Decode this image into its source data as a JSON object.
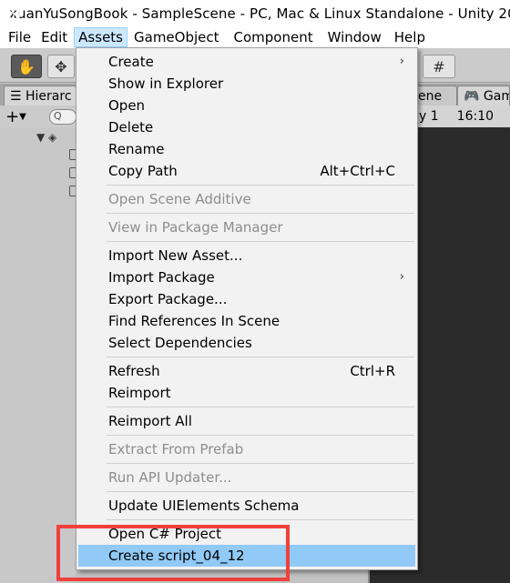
{
  "window": {
    "title": "xuanYuSongBook - SampleScene - PC, Mac & Linux Standalone - Unity 20"
  },
  "menubar": {
    "items": [
      "File",
      "Edit",
      "Assets",
      "GameObject",
      "Component",
      "Window",
      "Help"
    ]
  },
  "editor": {
    "tabs": {
      "hierarchy": "Hierarc",
      "scene": "ene",
      "game": "Gam"
    },
    "toolbar_right": {
      "display": "y 1",
      "time": "16:10"
    },
    "search_placeholder": "Q"
  },
  "assets_menu": {
    "items": [
      {
        "label": "Create",
        "submenu": true
      },
      {
        "label": "Show in Explorer"
      },
      {
        "label": "Open"
      },
      {
        "label": "Delete"
      },
      {
        "label": "Rename"
      },
      {
        "label": "Copy Path",
        "shortcut": "Alt+Ctrl+C"
      },
      {
        "label": "Open Scene Additive",
        "disabled": true
      },
      {
        "label": "View in Package Manager",
        "disabled": true
      },
      {
        "label": "Import New Asset..."
      },
      {
        "label": "Import Package",
        "submenu": true
      },
      {
        "label": "Export Package..."
      },
      {
        "label": "Find References In Scene"
      },
      {
        "label": "Select Dependencies"
      },
      {
        "label": "Refresh",
        "shortcut": "Ctrl+R"
      },
      {
        "label": "Reimport"
      },
      {
        "label": "Reimport All"
      },
      {
        "label": "Extract From Prefab",
        "disabled": true
      },
      {
        "label": "Run API Updater...",
        "disabled": true
      },
      {
        "label": "Update UIElements Schema"
      },
      {
        "label": "Open C# Project"
      },
      {
        "label": "Create script_04_12",
        "highlighted": true
      }
    ]
  },
  "colors": {
    "menu_highlight": "#91c9f7",
    "active_menu": "#cce8ff",
    "annotation": "#f0403c",
    "disabled_text": "#8d8d8d"
  }
}
